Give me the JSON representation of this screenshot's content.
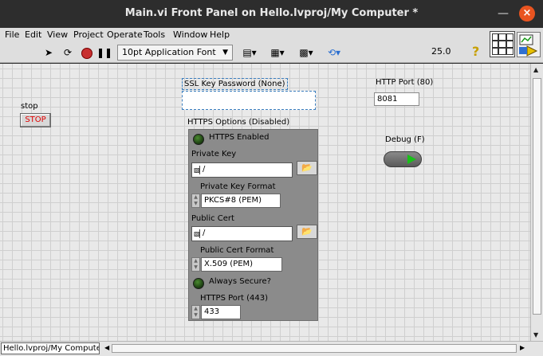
{
  "window": {
    "title": "Main.vi Front Panel on Hello.lvproj/My Computer *"
  },
  "menu": [
    "File",
    "Edit",
    "View",
    "Project",
    "Operate",
    "Tools",
    "Window",
    "Help"
  ],
  "toolbar": {
    "font_select": "10pt Application Font",
    "zoom": "25.0",
    "help": "?",
    "icons": [
      "run-arrow-icon",
      "run-continuous-icon",
      "abort-icon",
      "pause-icon",
      "align-icon",
      "distribute-icon",
      "resize-icon",
      "reorder-icon"
    ]
  },
  "panel": {
    "stop": {
      "label": "stop",
      "button": "STOP"
    },
    "ssl": {
      "label": "SSL Key Password (None)",
      "value": ""
    },
    "http_port": {
      "label": "HTTP Port (80)",
      "value": "8081"
    },
    "debug": {
      "label": "Debug (F)"
    },
    "https_cluster": {
      "label": "HTTPS Options (Disabled)",
      "https_enabled": "HTTPS Enabled",
      "private_key": {
        "label": "Private Key",
        "value": "/"
      },
      "private_key_format": {
        "label": "Private Key Format",
        "value": "PKCS#8 (PEM)"
      },
      "public_cert": {
        "label": "Public Cert",
        "value": "/"
      },
      "public_cert_format": {
        "label": "Public Cert Format",
        "value": "X.509 (PEM)"
      },
      "always_secure": "Always Secure?",
      "https_port": {
        "label": "HTTPS Port (443)",
        "value": "433"
      }
    }
  },
  "statusbar": {
    "project": "Hello.lvproj/My Computer"
  },
  "colors": {
    "titlebar": "#2d2d2d",
    "close": "#e95420",
    "panel": "#e9e9e9",
    "cluster": "#8b8b8b",
    "stop_text": "#e00000",
    "led_on": "#19c019"
  }
}
